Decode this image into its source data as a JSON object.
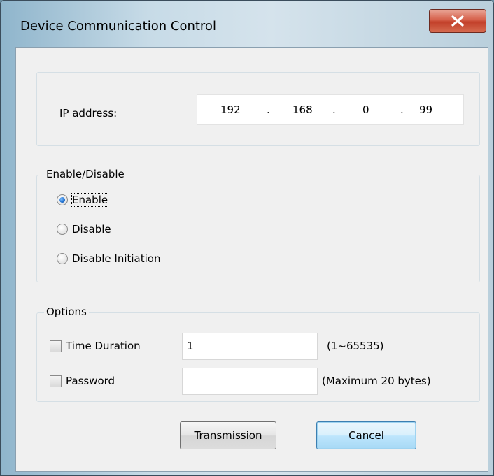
{
  "window": {
    "title": "Device Communication Control",
    "close_glyph": "X"
  },
  "ip": {
    "label": "IP address:",
    "octets": [
      "192",
      "168",
      "0",
      "99"
    ],
    "separator": "."
  },
  "mode_group": {
    "legend": "Enable/Disable",
    "options": [
      "Enable",
      "Disable",
      "Disable Initiation"
    ],
    "selected": "Enable"
  },
  "options_group": {
    "legend": "Options",
    "time_duration": {
      "label": "Time Duration",
      "checked": false,
      "value": "1",
      "hint": "(1~65535)"
    },
    "password": {
      "label": "Password",
      "checked": false,
      "value": "",
      "hint": "(Maximum 20 bytes)"
    }
  },
  "buttons": {
    "transmit": "Transmission",
    "cancel": "Cancel"
  },
  "colors": {
    "close_button": "#c2402a",
    "dialog_bg": "#f0f0f0",
    "default_button": "#bee6fd",
    "radio_selected": "#1f6fcf"
  }
}
